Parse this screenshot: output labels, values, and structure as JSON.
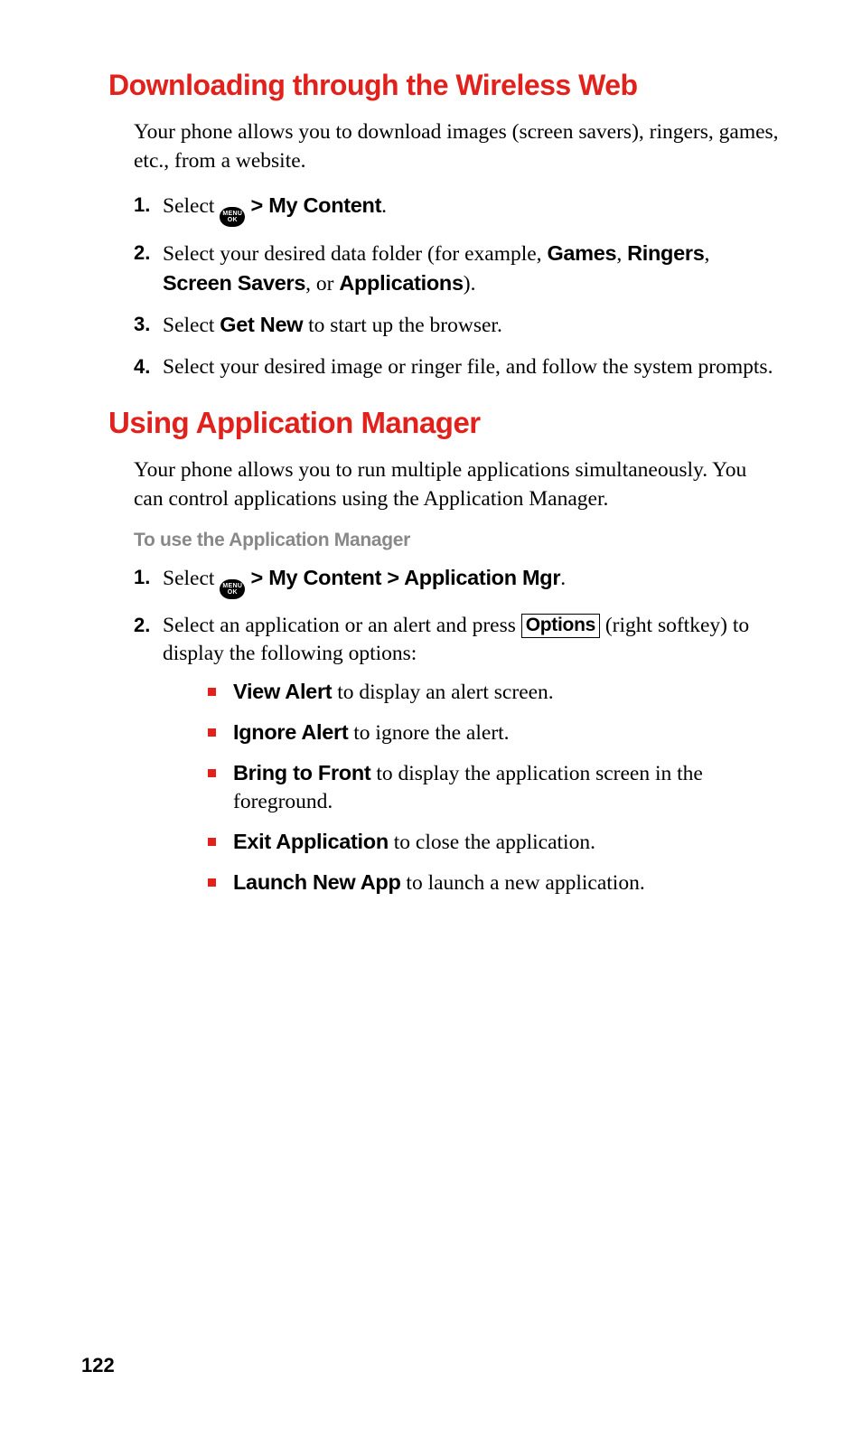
{
  "page_number": "122",
  "section1": {
    "heading": "Downloading through the Wireless Web",
    "intro": "Your phone allows you to download images (screen savers), ringers, games, etc., from a website.",
    "steps": {
      "s1": {
        "pre": "Select ",
        "menu_top": "MENU",
        "menu_bot": "OK",
        "gt": " > ",
        "bold": "My Content",
        "post": "."
      },
      "s2": {
        "pre": "Select your desired data folder (for example, ",
        "b1": "Games",
        "c1": ", ",
        "b2": "Ringers",
        "c2": ", ",
        "b3": "Screen Savers",
        "c3": ", or ",
        "b4": "Applications",
        "post": ")."
      },
      "s3": {
        "pre": "Select ",
        "bold": "Get New",
        "post": " to start up the browser."
      },
      "s4": {
        "text": "Select your desired image or ringer file, and follow the system prompts."
      }
    }
  },
  "section2": {
    "heading": "Using Application Manager",
    "intro": "Your phone allows you to run multiple applications simultaneously. You can control applications using the Application Manager.",
    "subhead": "To use the Application Manager",
    "steps": {
      "s1": {
        "pre": "Select ",
        "menu_top": "MENU",
        "menu_bot": "OK",
        "gt": " > ",
        "b1": "My Content",
        "gt2": " > ",
        "b2": "Application Mgr",
        "post": "."
      },
      "s2": {
        "pre": "Select an application or an alert and press ",
        "box": "Options",
        "post": " (right softkey) to display the following options:"
      }
    },
    "bullets": {
      "b1": {
        "bold": "View Alert",
        "text": " to display an alert screen."
      },
      "b2": {
        "bold": "Ignore Alert",
        "text": " to ignore the alert."
      },
      "b3": {
        "bold": "Bring to Front",
        "text": " to display the application screen in the foreground."
      },
      "b4": {
        "bold": "Exit Application",
        "text": " to close the application."
      },
      "b5": {
        "bold": "Launch New App",
        "text": " to launch a new application."
      }
    }
  }
}
